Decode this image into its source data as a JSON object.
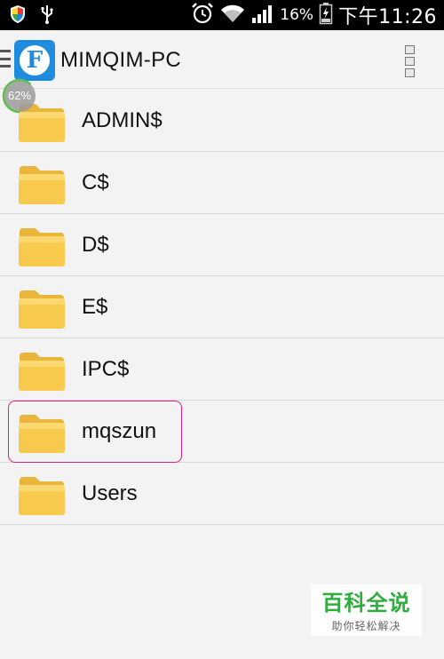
{
  "status_bar": {
    "battery_percent": "16%",
    "time": "下午11:26",
    "icons": [
      "shield-icon",
      "usb-icon",
      "alarm-icon",
      "wifi-icon",
      "signal-icon",
      "battery-icon"
    ]
  },
  "action_bar": {
    "title": "MIMQIM-PC",
    "logo_letter": "F",
    "menu_icon": "overflow-menu-icon"
  },
  "progress": {
    "label": "62%",
    "value": 0.62
  },
  "files": {
    "items": [
      {
        "label": "ADMIN$"
      },
      {
        "label": "C$"
      },
      {
        "label": "D$"
      },
      {
        "label": "E$"
      },
      {
        "label": "IPC$"
      },
      {
        "label": "mqszun"
      },
      {
        "label": "Users"
      }
    ],
    "selected_label": "mqszun"
  },
  "watermark": {
    "title": "百科全说",
    "subtitle": "助你轻松解决"
  },
  "colors": {
    "accent_blue": "#1f8ce0",
    "highlight_pink": "#d6207e",
    "folder_yellow": "#f7c94c",
    "progress_green": "#5cc24a",
    "watermark_green": "#2fae3f"
  }
}
